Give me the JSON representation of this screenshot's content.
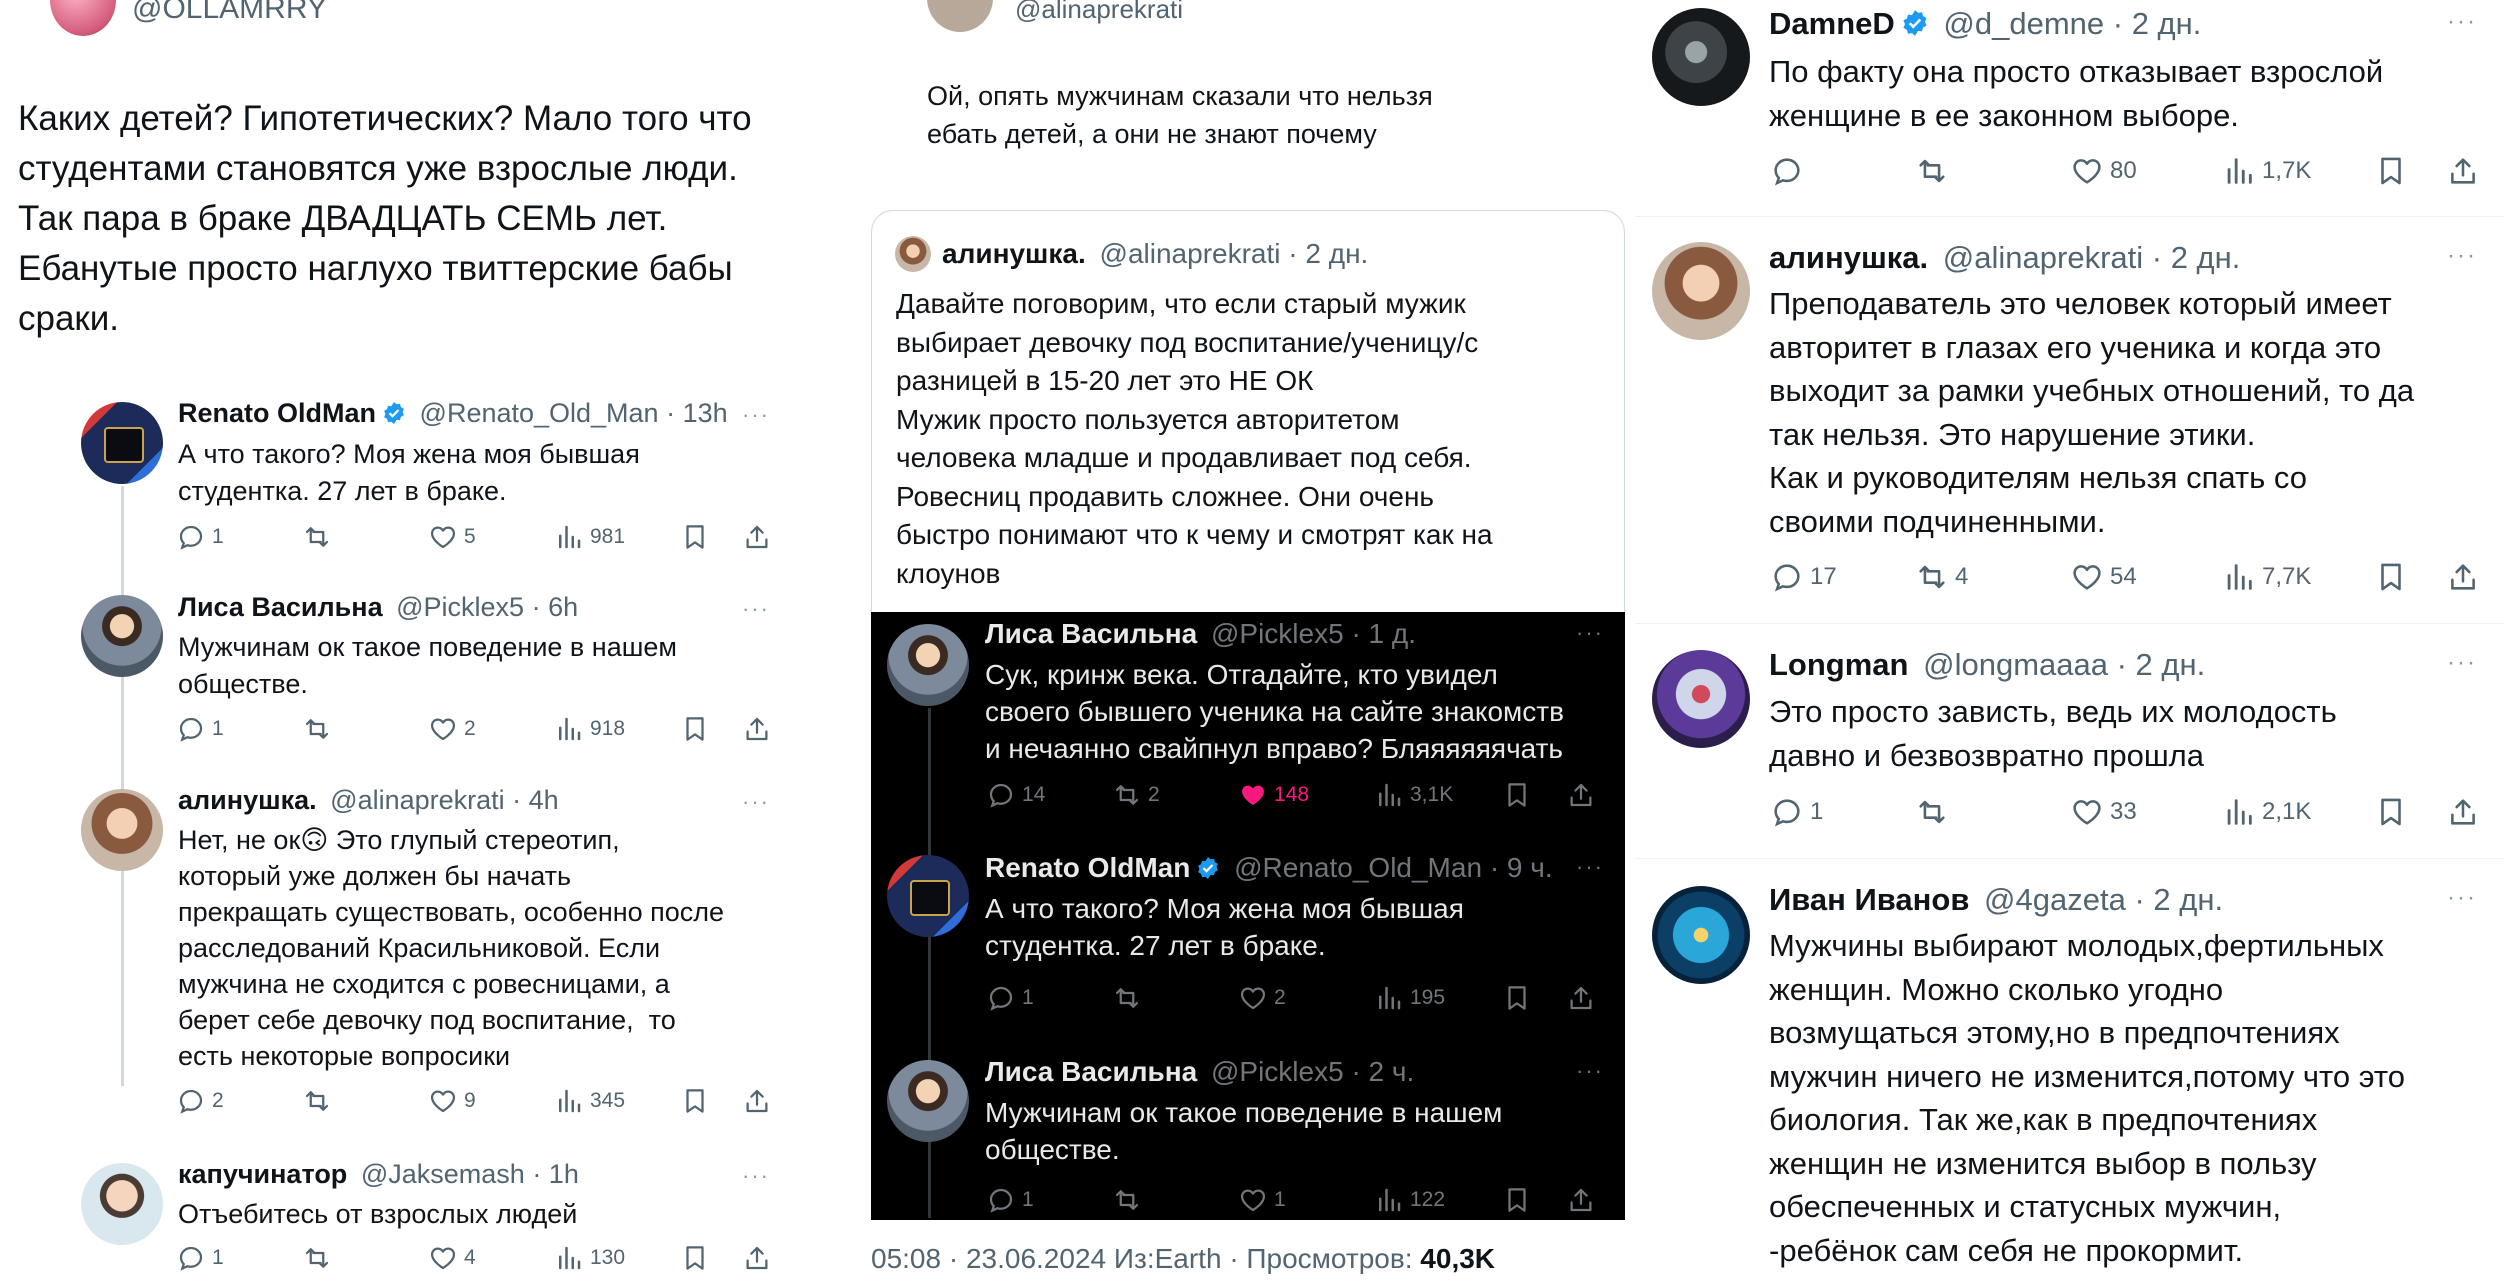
{
  "col1": {
    "top_handle": "@OLLAMRRY",
    "main_text": "Каких детей? Гипотетических? Мало того что\nстудентами становятся уже взрослые люди.\nТак пара в браке ДВАДЦАТЬ СЕМЬ лет.\nЕбанутые просто наглухо твиттерские бабы\nсраки.",
    "replies": [
      {
        "name": "Renato OldMan",
        "verified": true,
        "handle": "@Renato_Old_Man",
        "time": "· 13h",
        "text": "А что такого? Моя жена моя бывшая\nстудентка. 27 лет в браке.",
        "reply": "1",
        "retweet": "",
        "like": "5",
        "views": "981"
      },
      {
        "name": "Лиса Васильна",
        "verified": false,
        "handle": "@Picklex5",
        "time": "· 6h",
        "text": "Мужчинам ок такое поведение в нашем\nобществе.",
        "reply": "1",
        "retweet": "",
        "like": "2",
        "views": "918"
      },
      {
        "name": "алинушка.",
        "verified": false,
        "handle": "@alinaprekrati",
        "time": "· 4h",
        "text": "Нет, не ок🙃 Это глупый стереотип,\nкоторый уже должен бы начать\nпрекращать существовать, особенно после\nрасследований Красильниковой. Если\nмужчина не сходится с ровесницами, а\nберет себе девочку под воспитание,  то\nесть некоторые вопросики",
        "reply": "2",
        "retweet": "",
        "like": "9",
        "views": "345"
      },
      {
        "name": "капучинатор",
        "verified": false,
        "handle": "@Jaksemash",
        "time": "· 1h",
        "text": "Отъебитесь от взрослых людей",
        "reply": "1",
        "retweet": "",
        "like": "4",
        "views": "130"
      }
    ]
  },
  "col2": {
    "top_handle": "@alinaprekrati",
    "main_text": "Ой, опять мужчинам сказали что нельзя\nебать детей, а они не знают почему",
    "quote": {
      "name": "алинушка.",
      "handle": "@alinaprekrati",
      "time": "· 2 дн.",
      "text": "Давайте поговорим, что если старый мужик\nвыбирает девочку под воспитание/ученицу/с\nразницей в 15-20 лет это НЕ ОК\nМужик просто пользуется авторитетом\nчеловека младше и продавливает под себя.\nРовесниц продавить сложнее. Они очень\nбыстро понимают что к чему и смотрят как на\nклоунов"
    },
    "dark_replies": [
      {
        "name": "Лиса Васильна",
        "verified": false,
        "handle": "@Picklex5",
        "time": "· 1 д.",
        "text": "Сук, кринж века. Отгадайте, кто увидел\nсвоего бывшего ученика на сайте знакомств\nи нечаянно свайпнул вправо? Бляяяяяячать",
        "reply": "14",
        "retweet": "2",
        "like": "148",
        "liked": true,
        "views": "3,1K"
      },
      {
        "name": "Renato OldMan",
        "verified": true,
        "handle": "@Renato_Old_Man",
        "time": "· 9 ч.",
        "text": "А что такого? Моя жена моя бывшая\nстудентка. 27 лет в браке.",
        "reply": "1",
        "retweet": "",
        "like": "2",
        "liked": false,
        "views": "195"
      },
      {
        "name": "Лиса Васильна",
        "verified": false,
        "handle": "@Picklex5",
        "time": "· 2 ч.",
        "text": "Мужчинам ок такое поведение в нашем\nобществе.",
        "reply": "1",
        "retweet": "",
        "like": "1",
        "liked": false,
        "views": "122"
      }
    ],
    "footer_meta": "05:08 · 23.06.2024 Из:Earth · Просмотров: ",
    "footer_views": "40,3K"
  },
  "col3": {
    "replies": [
      {
        "name": "DamneD",
        "verified": true,
        "handle": "@d_demne",
        "time": "· 2 дн.",
        "text": "По факту она просто отказывает взрослой\nженщине в ее законном выборе.",
        "reply": "",
        "retweet": "",
        "like": "80",
        "views": "1,7K"
      },
      {
        "name": "алинушка.",
        "verified": false,
        "handle": "@alinaprekrati",
        "time": "· 2 дн.",
        "text": "Преподаватель это человек который имеет\nавторитет в глазах его ученика и когда это\nвыходит за рамки учебных отношений, то да\nтак нельзя. Это нарушение этики.\nКак и руководителям нельзя спать со\nсвоими подчиненными.",
        "reply": "17",
        "retweet": "4",
        "like": "54",
        "views": "7,7K"
      },
      {
        "name": "Longman",
        "verified": false,
        "handle": "@longmaaaa",
        "time": "· 2 дн.",
        "text": "Это просто зависть, ведь их молодость\nдавно и безвозвратно прошла",
        "reply": "1",
        "retweet": "",
        "like": "33",
        "views": "2,1K"
      },
      {
        "name": "Иван Иванов",
        "verified": false,
        "handle": "@4gazeta",
        "time": "· 2 дн.",
        "text": "Мужчины выбирают молодых,фертильных\nженщин. Можно сколько угодно\nвозмущаться этому,но в предпочтениях\nмужчин ничего не изменится,потому что это\nбиология. Так же,как в предпочтениях\nженщин не изменится выбор в пользу\nобеспеченных и статусных мужчин,\n-ребёнок сам себя не прокормит."
      }
    ]
  },
  "colors": {
    "text": "#0f1419",
    "secondary": "#536471",
    "verified": "#1d9bf0",
    "like_active": "#f91880",
    "dark_bg": "#000000"
  },
  "icons": [
    "reply-icon",
    "retweet-icon",
    "like-icon",
    "views-icon",
    "bookmark-icon",
    "share-icon",
    "verified-icon",
    "more-icon"
  ]
}
